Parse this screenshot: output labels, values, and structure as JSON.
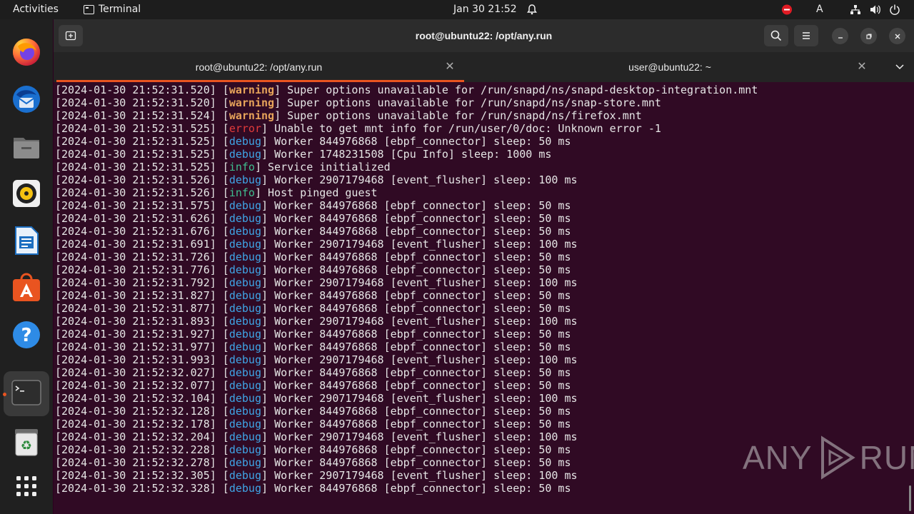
{
  "topbar": {
    "activities": "Activities",
    "app_name": "Terminal",
    "clock": "Jan 30  21:52",
    "input_indicator": "A"
  },
  "window": {
    "title": "root@ubuntu22: /opt/any.run",
    "tabs": [
      {
        "label": "root@ubuntu22: /opt/any.run",
        "active": true
      },
      {
        "label": "user@ubuntu22: ~",
        "active": false
      }
    ]
  },
  "terminal": {
    "lines": [
      {
        "ts": "[2024-01-30 21:52:31.520]",
        "level": "warning",
        "msg": "Super options unavailable for /run/snapd/ns/snapd-desktop-integration.mnt"
      },
      {
        "ts": "[2024-01-30 21:52:31.520]",
        "level": "warning",
        "msg": "Super options unavailable for /run/snapd/ns/snap-store.mnt"
      },
      {
        "ts": "[2024-01-30 21:52:31.524]",
        "level": "warning",
        "msg": "Super options unavailable for /run/snapd/ns/firefox.mnt"
      },
      {
        "ts": "[2024-01-30 21:52:31.525]",
        "level": "error",
        "msg": "Unable to get mnt info for /run/user/0/doc: Unknown error -1"
      },
      {
        "ts": "[2024-01-30 21:52:31.525]",
        "level": "debug",
        "msg": "Worker 844976868 [ebpf_connector] sleep: 50 ms"
      },
      {
        "ts": "[2024-01-30 21:52:31.525]",
        "level": "debug",
        "msg": "Worker 1748231508 [Cpu Info] sleep: 1000 ms"
      },
      {
        "ts": "[2024-01-30 21:52:31.525]",
        "level": "info",
        "msg": "Service initialized"
      },
      {
        "ts": "[2024-01-30 21:52:31.526]",
        "level": "debug",
        "msg": "Worker 2907179468 [event_flusher] sleep: 100 ms"
      },
      {
        "ts": "[2024-01-30 21:52:31.526]",
        "level": "info",
        "msg": "Host pinged guest"
      },
      {
        "ts": "[2024-01-30 21:52:31.575]",
        "level": "debug",
        "msg": "Worker 844976868 [ebpf_connector] sleep: 50 ms"
      },
      {
        "ts": "[2024-01-30 21:52:31.626]",
        "level": "debug",
        "msg": "Worker 844976868 [ebpf_connector] sleep: 50 ms"
      },
      {
        "ts": "[2024-01-30 21:52:31.676]",
        "level": "debug",
        "msg": "Worker 844976868 [ebpf_connector] sleep: 50 ms"
      },
      {
        "ts": "[2024-01-30 21:52:31.691]",
        "level": "debug",
        "msg": "Worker 2907179468 [event_flusher] sleep: 100 ms"
      },
      {
        "ts": "[2024-01-30 21:52:31.726]",
        "level": "debug",
        "msg": "Worker 844976868 [ebpf_connector] sleep: 50 ms"
      },
      {
        "ts": "[2024-01-30 21:52:31.776]",
        "level": "debug",
        "msg": "Worker 844976868 [ebpf_connector] sleep: 50 ms"
      },
      {
        "ts": "[2024-01-30 21:52:31.792]",
        "level": "debug",
        "msg": "Worker 2907179468 [event_flusher] sleep: 100 ms"
      },
      {
        "ts": "[2024-01-30 21:52:31.827]",
        "level": "debug",
        "msg": "Worker 844976868 [ebpf_connector] sleep: 50 ms"
      },
      {
        "ts": "[2024-01-30 21:52:31.877]",
        "level": "debug",
        "msg": "Worker 844976868 [ebpf_connector] sleep: 50 ms"
      },
      {
        "ts": "[2024-01-30 21:52:31.893]",
        "level": "debug",
        "msg": "Worker 2907179468 [event_flusher] sleep: 100 ms"
      },
      {
        "ts": "[2024-01-30 21:52:31.927]",
        "level": "debug",
        "msg": "Worker 844976868 [ebpf_connector] sleep: 50 ms"
      },
      {
        "ts": "[2024-01-30 21:52:31.977]",
        "level": "debug",
        "msg": "Worker 844976868 [ebpf_connector] sleep: 50 ms"
      },
      {
        "ts": "[2024-01-30 21:52:31.993]",
        "level": "debug",
        "msg": "Worker 2907179468 [event_flusher] sleep: 100 ms"
      },
      {
        "ts": "[2024-01-30 21:52:32.027]",
        "level": "debug",
        "msg": "Worker 844976868 [ebpf_connector] sleep: 50 ms"
      },
      {
        "ts": "[2024-01-30 21:52:32.077]",
        "level": "debug",
        "msg": "Worker 844976868 [ebpf_connector] sleep: 50 ms"
      },
      {
        "ts": "[2024-01-30 21:52:32.104]",
        "level": "debug",
        "msg": "Worker 2907179468 [event_flusher] sleep: 100 ms"
      },
      {
        "ts": "[2024-01-30 21:52:32.128]",
        "level": "debug",
        "msg": "Worker 844976868 [ebpf_connector] sleep: 50 ms"
      },
      {
        "ts": "[2024-01-30 21:52:32.178]",
        "level": "debug",
        "msg": "Worker 844976868 [ebpf_connector] sleep: 50 ms"
      },
      {
        "ts": "[2024-01-30 21:52:32.204]",
        "level": "debug",
        "msg": "Worker 2907179468 [event_flusher] sleep: 100 ms"
      },
      {
        "ts": "[2024-01-30 21:52:32.228]",
        "level": "debug",
        "msg": "Worker 844976868 [ebpf_connector] sleep: 50 ms"
      },
      {
        "ts": "[2024-01-30 21:52:32.278]",
        "level": "debug",
        "msg": "Worker 844976868 [ebpf_connector] sleep: 50 ms"
      },
      {
        "ts": "[2024-01-30 21:52:32.305]",
        "level": "debug",
        "msg": "Worker 2907179468 [event_flusher] sleep: 100 ms"
      },
      {
        "ts": "[2024-01-30 21:52:32.328]",
        "level": "debug",
        "msg": "Worker 844976868 [ebpf_connector] sleep: 50 ms"
      }
    ]
  },
  "dock": {
    "apps": [
      "firefox-icon",
      "thunderbird-icon",
      "files-icon",
      "rhythmbox-icon",
      "libreoffice-writer-icon",
      "app-center-icon",
      "help-icon",
      "terminal-icon",
      "trash-icon",
      "show-apps-icon"
    ]
  },
  "watermark": {
    "left": "ANY",
    "right": "RUN"
  },
  "colors": {
    "terminal_bg": "#300a24",
    "accent": "#e95420",
    "warning": "#e6a35a",
    "error": "#e33b3b",
    "debug": "#3fa5e6",
    "info": "#3fbf8f"
  }
}
